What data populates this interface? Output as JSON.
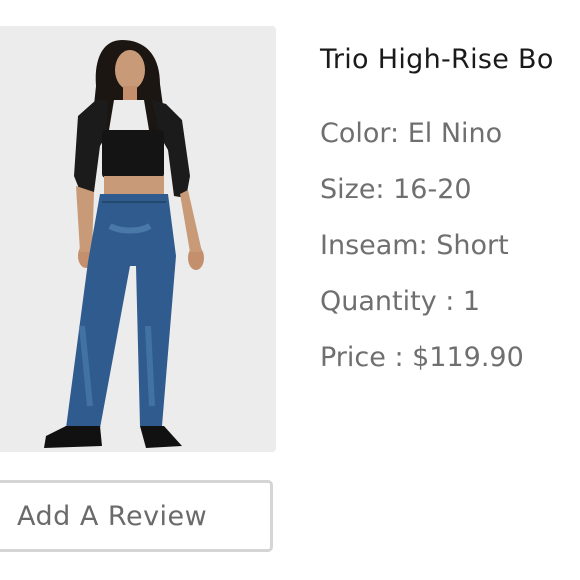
{
  "product": {
    "title": "Trio High-Rise Bo",
    "color": "Color: El Nino",
    "size": "Size: 16-20",
    "inseam": "Inseam: Short",
    "quantity": "Quantity : 1",
    "price": "Price : $119.90"
  },
  "actions": {
    "review_label": "Add A Review"
  },
  "colors": {
    "title": "#1a1a1a",
    "attribute_text": "#6f6f6f",
    "image_background": "#ececec",
    "button_border": "#d5d5d5"
  }
}
